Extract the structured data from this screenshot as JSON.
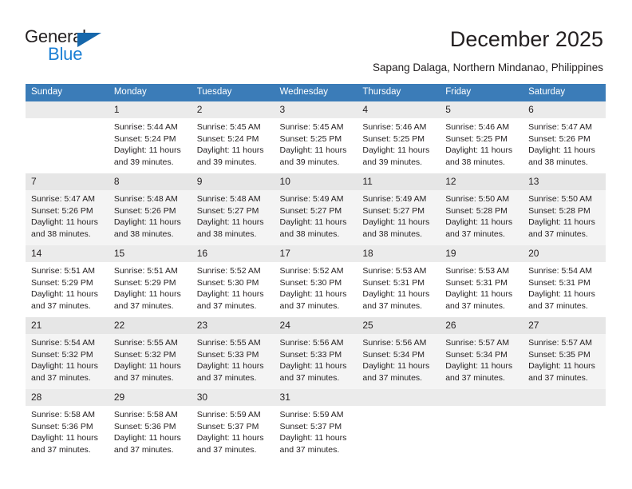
{
  "brand": {
    "name_top": "General",
    "name_bottom": "Blue",
    "triangle_icon": "blue-triangle-logo-mark",
    "accent_color": "#1667ab",
    "blue_text_color": "#1b7fd4"
  },
  "header": {
    "title": "December 2025",
    "subtitle": "Sapang Dalaga, Northern Mindanao, Philippines",
    "header_band_color": "#3b7cb8"
  },
  "calendar": {
    "weekday_headers": [
      "Sunday",
      "Monday",
      "Tuesday",
      "Wednesday",
      "Thursday",
      "Friday",
      "Saturday"
    ],
    "labels": {
      "sunrise": "Sunrise:",
      "sunset": "Sunset:",
      "daylight": "Daylight:"
    },
    "weeks": [
      [
        {
          "day": "",
          "empty": true
        },
        {
          "day": "1",
          "sunrise": "Sunrise: 5:44 AM",
          "sunset": "Sunset: 5:24 PM",
          "daylight": "Daylight: 11 hours and 39 minutes."
        },
        {
          "day": "2",
          "sunrise": "Sunrise: 5:45 AM",
          "sunset": "Sunset: 5:24 PM",
          "daylight": "Daylight: 11 hours and 39 minutes."
        },
        {
          "day": "3",
          "sunrise": "Sunrise: 5:45 AM",
          "sunset": "Sunset: 5:25 PM",
          "daylight": "Daylight: 11 hours and 39 minutes."
        },
        {
          "day": "4",
          "sunrise": "Sunrise: 5:46 AM",
          "sunset": "Sunset: 5:25 PM",
          "daylight": "Daylight: 11 hours and 39 minutes."
        },
        {
          "day": "5",
          "sunrise": "Sunrise: 5:46 AM",
          "sunset": "Sunset: 5:25 PM",
          "daylight": "Daylight: 11 hours and 38 minutes."
        },
        {
          "day": "6",
          "sunrise": "Sunrise: 5:47 AM",
          "sunset": "Sunset: 5:26 PM",
          "daylight": "Daylight: 11 hours and 38 minutes."
        }
      ],
      [
        {
          "day": "7",
          "sunrise": "Sunrise: 5:47 AM",
          "sunset": "Sunset: 5:26 PM",
          "daylight": "Daylight: 11 hours and 38 minutes."
        },
        {
          "day": "8",
          "sunrise": "Sunrise: 5:48 AM",
          "sunset": "Sunset: 5:26 PM",
          "daylight": "Daylight: 11 hours and 38 minutes."
        },
        {
          "day": "9",
          "sunrise": "Sunrise: 5:48 AM",
          "sunset": "Sunset: 5:27 PM",
          "daylight": "Daylight: 11 hours and 38 minutes."
        },
        {
          "day": "10",
          "sunrise": "Sunrise: 5:49 AM",
          "sunset": "Sunset: 5:27 PM",
          "daylight": "Daylight: 11 hours and 38 minutes."
        },
        {
          "day": "11",
          "sunrise": "Sunrise: 5:49 AM",
          "sunset": "Sunset: 5:27 PM",
          "daylight": "Daylight: 11 hours and 38 minutes."
        },
        {
          "day": "12",
          "sunrise": "Sunrise: 5:50 AM",
          "sunset": "Sunset: 5:28 PM",
          "daylight": "Daylight: 11 hours and 37 minutes."
        },
        {
          "day": "13",
          "sunrise": "Sunrise: 5:50 AM",
          "sunset": "Sunset: 5:28 PM",
          "daylight": "Daylight: 11 hours and 37 minutes."
        }
      ],
      [
        {
          "day": "14",
          "sunrise": "Sunrise: 5:51 AM",
          "sunset": "Sunset: 5:29 PM",
          "daylight": "Daylight: 11 hours and 37 minutes."
        },
        {
          "day": "15",
          "sunrise": "Sunrise: 5:51 AM",
          "sunset": "Sunset: 5:29 PM",
          "daylight": "Daylight: 11 hours and 37 minutes."
        },
        {
          "day": "16",
          "sunrise": "Sunrise: 5:52 AM",
          "sunset": "Sunset: 5:30 PM",
          "daylight": "Daylight: 11 hours and 37 minutes."
        },
        {
          "day": "17",
          "sunrise": "Sunrise: 5:52 AM",
          "sunset": "Sunset: 5:30 PM",
          "daylight": "Daylight: 11 hours and 37 minutes."
        },
        {
          "day": "18",
          "sunrise": "Sunrise: 5:53 AM",
          "sunset": "Sunset: 5:31 PM",
          "daylight": "Daylight: 11 hours and 37 minutes."
        },
        {
          "day": "19",
          "sunrise": "Sunrise: 5:53 AM",
          "sunset": "Sunset: 5:31 PM",
          "daylight": "Daylight: 11 hours and 37 minutes."
        },
        {
          "day": "20",
          "sunrise": "Sunrise: 5:54 AM",
          "sunset": "Sunset: 5:31 PM",
          "daylight": "Daylight: 11 hours and 37 minutes."
        }
      ],
      [
        {
          "day": "21",
          "sunrise": "Sunrise: 5:54 AM",
          "sunset": "Sunset: 5:32 PM",
          "daylight": "Daylight: 11 hours and 37 minutes."
        },
        {
          "day": "22",
          "sunrise": "Sunrise: 5:55 AM",
          "sunset": "Sunset: 5:32 PM",
          "daylight": "Daylight: 11 hours and 37 minutes."
        },
        {
          "day": "23",
          "sunrise": "Sunrise: 5:55 AM",
          "sunset": "Sunset: 5:33 PM",
          "daylight": "Daylight: 11 hours and 37 minutes."
        },
        {
          "day": "24",
          "sunrise": "Sunrise: 5:56 AM",
          "sunset": "Sunset: 5:33 PM",
          "daylight": "Daylight: 11 hours and 37 minutes."
        },
        {
          "day": "25",
          "sunrise": "Sunrise: 5:56 AM",
          "sunset": "Sunset: 5:34 PM",
          "daylight": "Daylight: 11 hours and 37 minutes."
        },
        {
          "day": "26",
          "sunrise": "Sunrise: 5:57 AM",
          "sunset": "Sunset: 5:34 PM",
          "daylight": "Daylight: 11 hours and 37 minutes."
        },
        {
          "day": "27",
          "sunrise": "Sunrise: 5:57 AM",
          "sunset": "Sunset: 5:35 PM",
          "daylight": "Daylight: 11 hours and 37 minutes."
        }
      ],
      [
        {
          "day": "28",
          "sunrise": "Sunrise: 5:58 AM",
          "sunset": "Sunset: 5:36 PM",
          "daylight": "Daylight: 11 hours and 37 minutes."
        },
        {
          "day": "29",
          "sunrise": "Sunrise: 5:58 AM",
          "sunset": "Sunset: 5:36 PM",
          "daylight": "Daylight: 11 hours and 37 minutes."
        },
        {
          "day": "30",
          "sunrise": "Sunrise: 5:59 AM",
          "sunset": "Sunset: 5:37 PM",
          "daylight": "Daylight: 11 hours and 37 minutes."
        },
        {
          "day": "31",
          "sunrise": "Sunrise: 5:59 AM",
          "sunset": "Sunset: 5:37 PM",
          "daylight": "Daylight: 11 hours and 37 minutes."
        },
        {
          "day": "",
          "empty": true
        },
        {
          "day": "",
          "empty": true
        },
        {
          "day": "",
          "empty": true
        }
      ]
    ]
  }
}
